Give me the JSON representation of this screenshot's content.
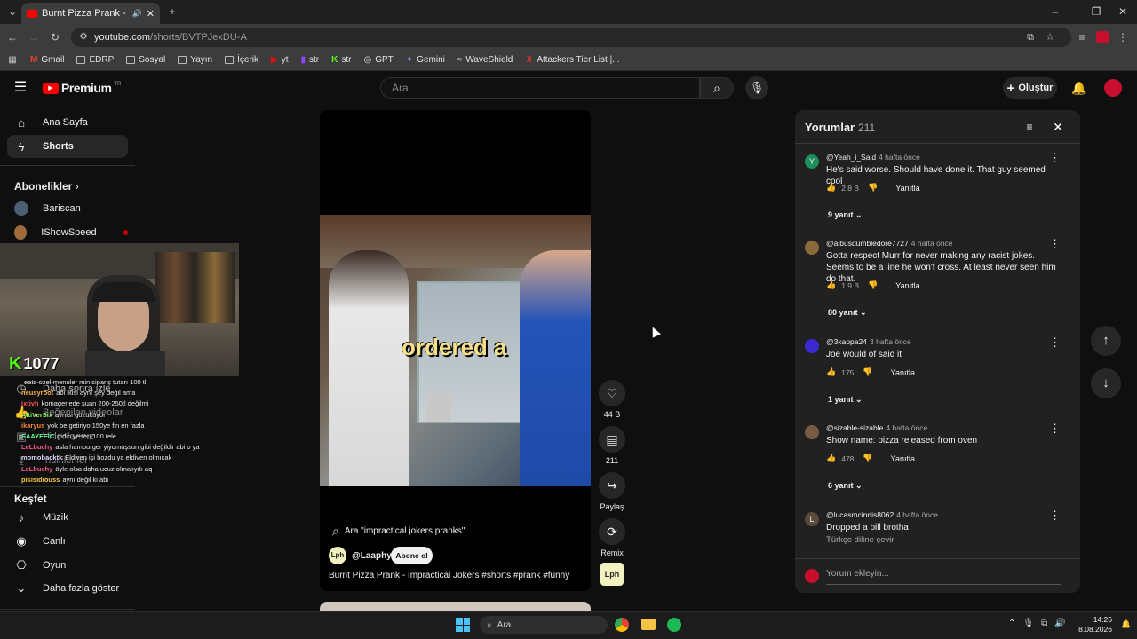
{
  "browser": {
    "tab_title": "Burnt Pizza Prank - Impract...",
    "url_domain": "youtube.com",
    "url_path": "/shorts/BVTPJexDU-A",
    "bookmarks": [
      "Gmail",
      "EDRP",
      "Sosyal",
      "Yayın",
      "İçerik",
      "yt",
      "str",
      "str",
      "GPT",
      "Gemini",
      "WaveShield",
      "Attackers Tier List |..."
    ]
  },
  "header": {
    "logo": "Premium",
    "logo_sup": "TR",
    "search_placeholder": "Ara",
    "create_label": "Oluştur"
  },
  "sidebar": {
    "home": "Ana Sayfa",
    "shorts": "Shorts",
    "subs_title": "Abonelikler",
    "subs": [
      "Bariscan",
      "IShowSpeed"
    ],
    "hidden": [
      "Daha sonra izle",
      "Beğenilen videolar",
      "Videolarınız",
      "İndirilenler"
    ],
    "explore_title": "Keşfet",
    "explore": [
      "Müzik",
      "Canlı",
      "Oyun",
      "Daha fazla göster"
    ]
  },
  "stream_overlay": {
    "kick_viewers": "1077",
    "chat": [
      {
        "user": "",
        "msg": "eats-ozel-menuler min sipariş tutarı 100 tl"
      },
      {
        "user": "neusyroot",
        "msg": "abi ikisi aynı şey değil ama"
      },
      {
        "user": "ixtivh",
        "msg": "komagenede şuan 200-250tl değilmi"
      },
      {
        "user": "AltiVerSix",
        "msg": "aynısı gözüküyor"
      },
      {
        "user": "ikaryus",
        "msg": "yok be getiriyo 150ye fin en fazla"
      },
      {
        "user": "SAAYFEIC",
        "msg": "gidip yesen 100 tele"
      },
      {
        "user": "LeLbuchy",
        "msg": "asla hamburger yiyomuşsun gibi değildir abi o ya"
      },
      {
        "user": "momobacktk",
        "msg": "Eldiven işi bozdu ya eldiven olmıcak"
      },
      {
        "user": "LeLbuchy",
        "msg": "öyle olsa daha ucuz olmalıydı aq"
      },
      {
        "user": "pisisidiouss",
        "msg": "aynı değil ki abi"
      }
    ]
  },
  "video": {
    "caption": "ordered a",
    "search_suggestion": "Ara \"impractical jokers pranks\"",
    "channel_avatar": "Lph",
    "channel": "@Laaphy",
    "subscribe": "Abone ol",
    "title": "Burnt Pizza Prank - Impractical Jokers #shorts #prank #funny",
    "likes": "44 B",
    "comments": "211",
    "share": "Paylaş",
    "remix": "Remix"
  },
  "comments": {
    "title": "Yorumlar",
    "count": "211",
    "add_placeholder": "Yorum ekleyin...",
    "reply_label": "Yanıtla",
    "translate": "Türkçe diline çevir",
    "items": [
      {
        "user": "@Yeah_i_Said",
        "time": "4 hafta önce",
        "text": "He's said worse. Should have done it. That guy seemed cool",
        "likes": "2,8 B",
        "replies": "9 yanıt",
        "avatar": "Y",
        "color": "#1e8e5a"
      },
      {
        "user": "@albusdumbledore7727",
        "time": "4 hafta önce",
        "text": "Gotta respect Murr for never making any racist jokes. Seems to be a line he won't cross. At least never seen him do that.",
        "likes": "1,9 B",
        "replies": "80 yanıt",
        "avatar": "",
        "color": "#8a6a3a"
      },
      {
        "user": "@3kappa24",
        "time": "3 hafta önce",
        "text": "Joe would of said it",
        "likes": "175",
        "replies": "1 yanıt",
        "avatar": "",
        "color": "#3a2ad0"
      },
      {
        "user": "@sizable-sizable",
        "time": "4 hafta önce",
        "text": "Show name: pizza released from oven",
        "likes": "478",
        "replies": "6 yanıt",
        "avatar": "",
        "color": "#7a5a40"
      },
      {
        "user": "@lucasmcinnis8062",
        "time": "4 hafta önce",
        "text": "Dropped a bill brotha",
        "likes": "",
        "replies": "",
        "avatar": "L",
        "color": "#5a4a3a"
      }
    ]
  },
  "taskbar": {
    "search": "Ara",
    "time": "14:26",
    "date": "8.08.2026"
  }
}
